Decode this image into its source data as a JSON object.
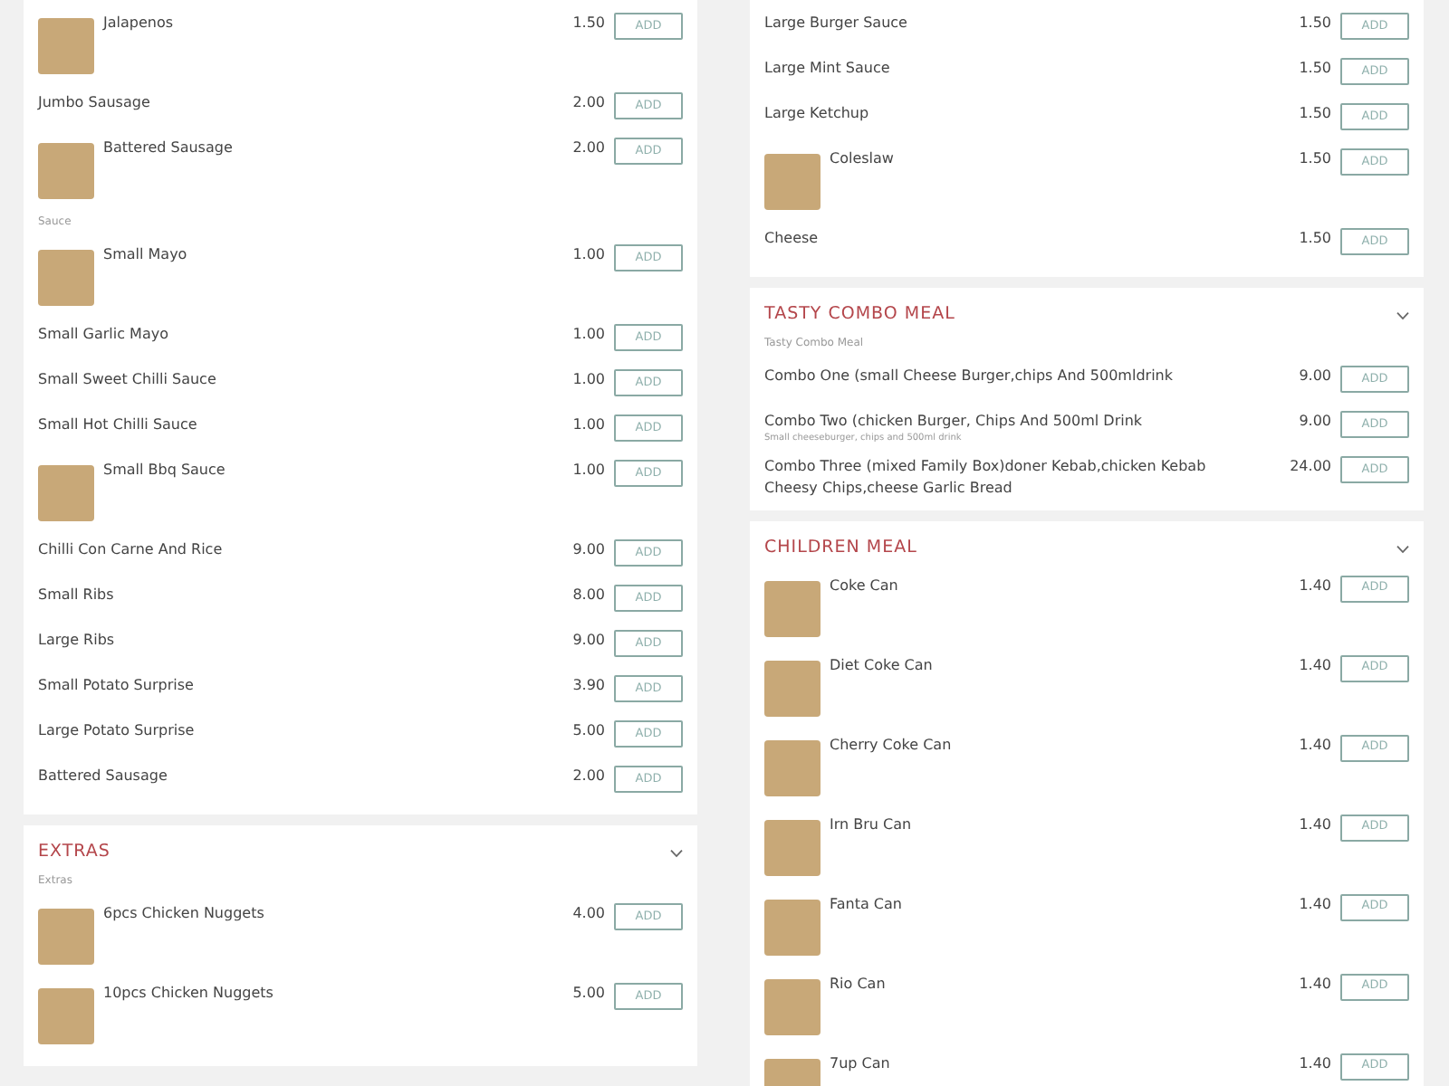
{
  "columns": [
    {
      "cards": [
        {
          "items": [
            {
              "kind": "item",
              "photo": true,
              "name": "Jalapenos",
              "price": "1.50",
              "button": "ADD"
            },
            {
              "kind": "item",
              "photo": false,
              "name": "Jumbo Sausage",
              "price": "2.00",
              "button": "ADD"
            },
            {
              "kind": "item",
              "photo": true,
              "name": "Battered Sausage",
              "price": "2.00",
              "button": "ADD"
            },
            {
              "kind": "category",
              "label": "Sauce"
            },
            {
              "kind": "item",
              "photo": true,
              "name": "Small Mayo",
              "price": "1.00",
              "button": "ADD"
            },
            {
              "kind": "item",
              "photo": false,
              "name": "Small Garlic Mayo",
              "price": "1.00",
              "button": "ADD"
            },
            {
              "kind": "item",
              "photo": false,
              "name": "Small Sweet Chilli Sauce",
              "price": "1.00",
              "button": "ADD"
            },
            {
              "kind": "item",
              "photo": false,
              "name": "Small Hot Chilli Sauce",
              "price": "1.00",
              "button": "ADD"
            },
            {
              "kind": "item",
              "photo": true,
              "name": "Small Bbq Sauce",
              "price": "1.00",
              "button": "ADD"
            },
            {
              "kind": "item",
              "photo": false,
              "name": "Chilli Con Carne And Rice",
              "price": "9.00",
              "button": "ADD"
            },
            {
              "kind": "item",
              "photo": false,
              "name": "Small Ribs",
              "price": "8.00",
              "button": "ADD"
            },
            {
              "kind": "item",
              "photo": false,
              "name": "Large Ribs",
              "price": "9.00",
              "button": "ADD"
            },
            {
              "kind": "item",
              "photo": false,
              "name": "Small Potato Surprise",
              "price": "3.90",
              "button": "ADD"
            },
            {
              "kind": "item",
              "photo": false,
              "name": "Large Potato Surprise",
              "price": "5.00",
              "button": "ADD"
            },
            {
              "kind": "item",
              "photo": false,
              "name": "Battered Sausage",
              "price": "2.00",
              "button": "ADD"
            }
          ]
        },
        {
          "title": "EXTRAS",
          "subtitle": "Extras",
          "items": [
            {
              "kind": "item",
              "photo": true,
              "name": "6pcs Chicken Nuggets",
              "price": "4.00",
              "button": "ADD"
            },
            {
              "kind": "item",
              "photo": true,
              "name": "10pcs Chicken Nuggets",
              "price": "5.00",
              "button": "ADD"
            }
          ]
        }
      ]
    },
    {
      "cards": [
        {
          "items": [
            {
              "kind": "item",
              "photo": false,
              "name": "Large Burger Sauce",
              "price": "1.50",
              "button": "ADD"
            },
            {
              "kind": "item",
              "photo": false,
              "name": "Large Mint Sauce",
              "price": "1.50",
              "button": "ADD"
            },
            {
              "kind": "item",
              "photo": false,
              "name": "Large Ketchup",
              "price": "1.50",
              "button": "ADD"
            },
            {
              "kind": "item",
              "photo": true,
              "name": "Coleslaw",
              "price": "1.50",
              "button": "ADD"
            },
            {
              "kind": "item",
              "photo": false,
              "name": "Cheese",
              "price": "1.50",
              "button": "ADD"
            }
          ]
        },
        {
          "title": "TASTY COMBO MEAL",
          "subtitle": "Tasty Combo Meal",
          "items": [
            {
              "kind": "item",
              "photo": false,
              "name": "Combo One (small Cheese Burger,chips And 500mldrink",
              "price": "9.00",
              "button": "ADD"
            },
            {
              "kind": "item",
              "photo": false,
              "name": "Combo Two (chicken Burger, Chips And 500ml Drink",
              "description": "Small cheeseburger, chips and 500ml drink",
              "price": "9.00",
              "button": "ADD"
            },
            {
              "kind": "item",
              "photo": false,
              "name": "Combo Three (mixed Family Box)doner Kebab,chicken Kebab Cheesy Chips,cheese Garlic Bread",
              "price": "24.00",
              "button": "ADD"
            }
          ]
        },
        {
          "title": "CHILDREN MEAL",
          "items": [
            {
              "kind": "item",
              "photo": true,
              "name": "Coke Can",
              "price": "1.40",
              "button": "ADD"
            },
            {
              "kind": "item",
              "photo": true,
              "name": "Diet Coke Can",
              "price": "1.40",
              "button": "ADD"
            },
            {
              "kind": "item",
              "photo": true,
              "name": "Cherry Coke Can",
              "price": "1.40",
              "button": "ADD"
            },
            {
              "kind": "item",
              "photo": true,
              "name": "Irn Bru Can",
              "price": "1.40",
              "button": "ADD"
            },
            {
              "kind": "item",
              "photo": true,
              "name": "Fanta Can",
              "price": "1.40",
              "button": "ADD"
            },
            {
              "kind": "item",
              "photo": true,
              "name": "Rio Can",
              "price": "1.40",
              "button": "ADD"
            },
            {
              "kind": "item",
              "photo": true,
              "name": "7up Can",
              "price": "1.40",
              "button": "ADD"
            }
          ]
        }
      ]
    }
  ]
}
